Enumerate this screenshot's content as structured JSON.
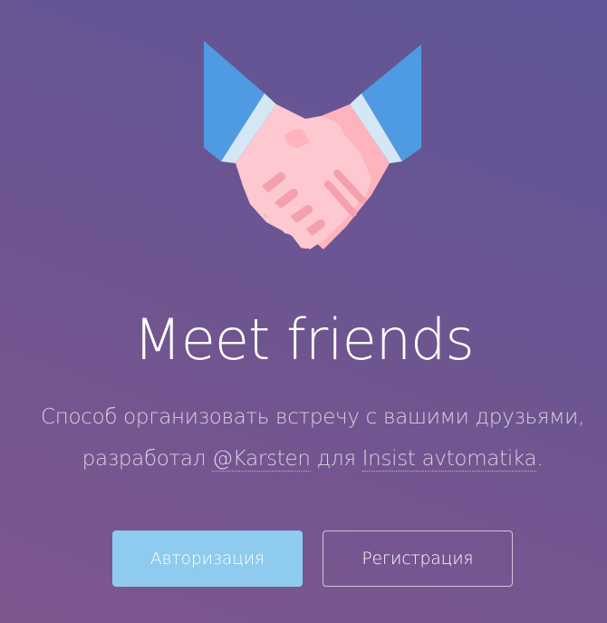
{
  "hero": {
    "icon": "handshake-icon",
    "title": "Meet friends"
  },
  "description": {
    "line1": "Способ организовать встречу с вашими друзьями,",
    "line2_prefix": "разработал",
    "author_link": "@Karsten",
    "line2_middle": "для",
    "company_link": "Insist avtomatika",
    "line2_suffix": "."
  },
  "actions": {
    "login_label": "Авторизация",
    "register_label": "Регистрация"
  },
  "colors": {
    "background_start": "#7e5690",
    "background_end": "#5f5597",
    "login_button": "#8ecbee",
    "sleeve_blue": "#4f9be3",
    "cuff_light": "#d3e7f5",
    "skin_light": "#fdc8cf",
    "skin_mid": "#ffb3bd",
    "finger_shadow": "#f5a0ae"
  }
}
